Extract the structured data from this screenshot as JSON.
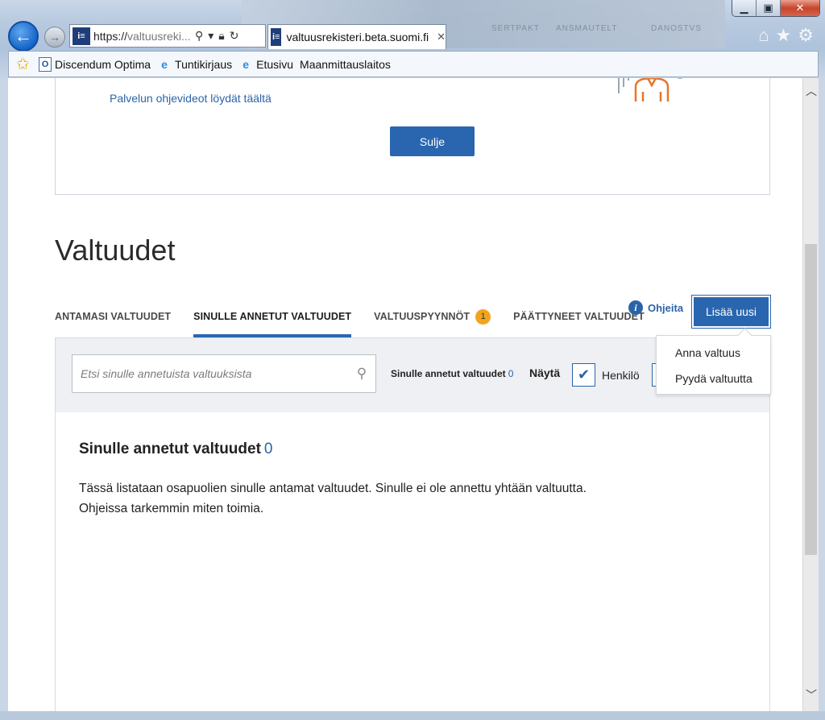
{
  "browser": {
    "address_url_main": "https://",
    "address_url_dim": "valtuusreki...",
    "tab_title": "valtuusrekisteri.beta.suomi.fi",
    "tab_close": "✕",
    "bg_labels": [
      "SERTPAKT",
      "ANSMAUTELT",
      "DANOSTVS"
    ]
  },
  "favorites": {
    "items": [
      {
        "label": "Discendum Optima",
        "icon": "o-icon"
      },
      {
        "label": "Tuntikirjaus",
        "icon": "ie-icon"
      },
      {
        "label": "Etusivu",
        "icon": "ie-icon"
      },
      {
        "label": "Maanmittauslaitos",
        "icon": "none"
      }
    ]
  },
  "notice": {
    "video_link": "Palvelun ohjevideot löydät täältä",
    "close_button": "Sulje"
  },
  "page": {
    "title": "Valtuudet"
  },
  "tabs": [
    {
      "label": "ANTAMASI VALTUUDET",
      "active": false
    },
    {
      "label": "SINULLE ANNETUT VALTUUDET",
      "active": true
    },
    {
      "label": "VALTUUSPYYNNÖT",
      "active": false,
      "badge": "1"
    },
    {
      "label": "PÄÄTTYNEET VALTUUDET",
      "active": false
    }
  ],
  "help": {
    "icon_glyph": "i",
    "label": "Ohjeita"
  },
  "add_button": "Lisää uusi",
  "dropdown": {
    "items": [
      "Anna valtuus",
      "Pyydä valtuutta"
    ]
  },
  "filter": {
    "search_placeholder": "Etsi sinulle annetuista valtuuksista",
    "count_label": "Sinulle annetut valtuudet",
    "count_value": "0",
    "show_label": "Näytä",
    "person_label": "Henkilö",
    "person_checked": true
  },
  "content": {
    "title": "Sinulle annetut valtuudet",
    "count": "0",
    "line1": "Tässä listataan osapuolien sinulle antamat valtuudet. Sinulle ei ole annettu yhtään valtuutta.",
    "line2": "Ohjeissa tarkemmin miten toimia."
  },
  "colors": {
    "primary": "#2a66b0",
    "badge": "#f1a51f",
    "link": "#2a64a8"
  }
}
